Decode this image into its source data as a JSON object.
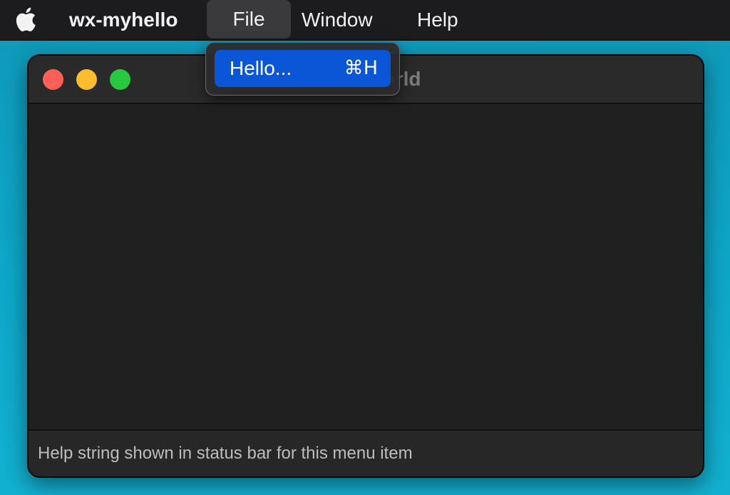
{
  "menubar": {
    "apple_icon": "apple-logo-icon",
    "app_name": "wx-myhello",
    "items": [
      {
        "label": "File"
      },
      {
        "label": "Window"
      },
      {
        "label": "Help"
      }
    ]
  },
  "window": {
    "title": "Hello World",
    "traffic_lights": [
      "close",
      "minimize",
      "zoom"
    ],
    "status_text": "Help string shown in status bar for this menu item"
  },
  "file_menu": {
    "items": [
      {
        "label": "Hello...",
        "shortcut": "⌘H",
        "highlighted": true
      }
    ]
  },
  "colors": {
    "desktop": "#0ea6c7",
    "menubar": "#1c1c1e",
    "window_bg": "#202020",
    "highlight": "#0a56d6",
    "traffic_close": "#fe5f57",
    "traffic_minimize": "#febc2e",
    "traffic_zoom": "#28c840"
  }
}
